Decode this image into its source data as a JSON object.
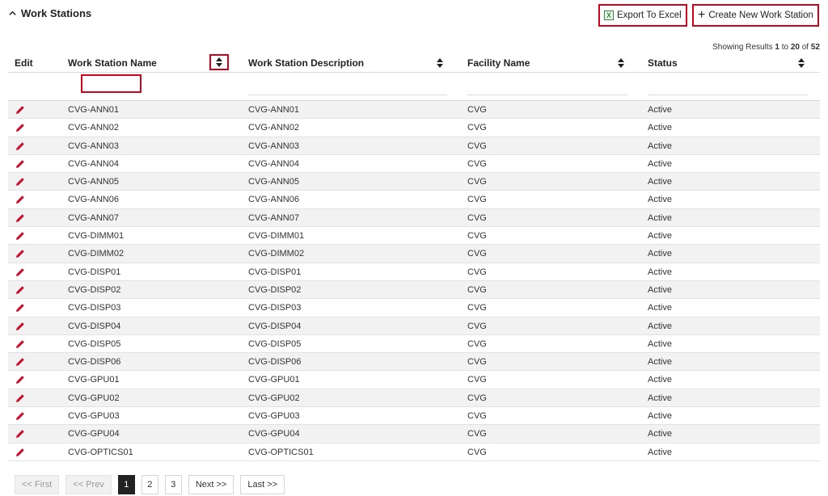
{
  "panel": {
    "title": "Work Stations"
  },
  "toolbar": {
    "export_label": "Export To Excel",
    "create_label": "Create New Work Station",
    "export_icon_glyph": "X"
  },
  "results": {
    "prefix": "Showing Results",
    "from": "1",
    "to_word": "to",
    "to": "20",
    "of_word": "of",
    "total": "52"
  },
  "columns": {
    "edit": "Edit",
    "name": "Work Station Name",
    "description": "Work Station Description",
    "facility": "Facility Name",
    "status": "Status"
  },
  "rows": [
    {
      "name": "CVG-ANN01",
      "description": "CVG-ANN01",
      "facility": "CVG",
      "status": "Active"
    },
    {
      "name": "CVG-ANN02",
      "description": "CVG-ANN02",
      "facility": "CVG",
      "status": "Active"
    },
    {
      "name": "CVG-ANN03",
      "description": "CVG-ANN03",
      "facility": "CVG",
      "status": "Active"
    },
    {
      "name": "CVG-ANN04",
      "description": "CVG-ANN04",
      "facility": "CVG",
      "status": "Active"
    },
    {
      "name": "CVG-ANN05",
      "description": "CVG-ANN05",
      "facility": "CVG",
      "status": "Active"
    },
    {
      "name": "CVG-ANN06",
      "description": "CVG-ANN06",
      "facility": "CVG",
      "status": "Active"
    },
    {
      "name": "CVG-ANN07",
      "description": "CVG-ANN07",
      "facility": "CVG",
      "status": "Active"
    },
    {
      "name": "CVG-DIMM01",
      "description": "CVG-DIMM01",
      "facility": "CVG",
      "status": "Active"
    },
    {
      "name": "CVG-DIMM02",
      "description": "CVG-DIMM02",
      "facility": "CVG",
      "status": "Active"
    },
    {
      "name": "CVG-DISP01",
      "description": "CVG-DISP01",
      "facility": "CVG",
      "status": "Active"
    },
    {
      "name": "CVG-DISP02",
      "description": "CVG-DISP02",
      "facility": "CVG",
      "status": "Active"
    },
    {
      "name": "CVG-DISP03",
      "description": "CVG-DISP03",
      "facility": "CVG",
      "status": "Active"
    },
    {
      "name": "CVG-DISP04",
      "description": "CVG-DISP04",
      "facility": "CVG",
      "status": "Active"
    },
    {
      "name": "CVG-DISP05",
      "description": "CVG-DISP05",
      "facility": "CVG",
      "status": "Active"
    },
    {
      "name": "CVG-DISP06",
      "description": "CVG-DISP06",
      "facility": "CVG",
      "status": "Active"
    },
    {
      "name": "CVG-GPU01",
      "description": "CVG-GPU01",
      "facility": "CVG",
      "status": "Active"
    },
    {
      "name": "CVG-GPU02",
      "description": "CVG-GPU02",
      "facility": "CVG",
      "status": "Active"
    },
    {
      "name": "CVG-GPU03",
      "description": "CVG-GPU03",
      "facility": "CVG",
      "status": "Active"
    },
    {
      "name": "CVG-GPU04",
      "description": "CVG-GPU04",
      "facility": "CVG",
      "status": "Active"
    },
    {
      "name": "CVG-OPTICS01",
      "description": "CVG-OPTICS01",
      "facility": "CVG",
      "status": "Active"
    }
  ],
  "pagination": {
    "first": "<< First",
    "prev": "<< Prev",
    "pages": [
      "1",
      "2",
      "3"
    ],
    "current": "1",
    "next": "Next >>",
    "last": "Last >>"
  },
  "colors": {
    "highlight": "#d0021b",
    "edit_icon": "#c8102e",
    "excel_icon": "#2e8b3a"
  },
  "icons": {
    "collapse": "chevron-up-icon",
    "edit": "pencil-icon",
    "sort": "sort-icon",
    "export": "excel-icon",
    "create": "plus-icon"
  }
}
